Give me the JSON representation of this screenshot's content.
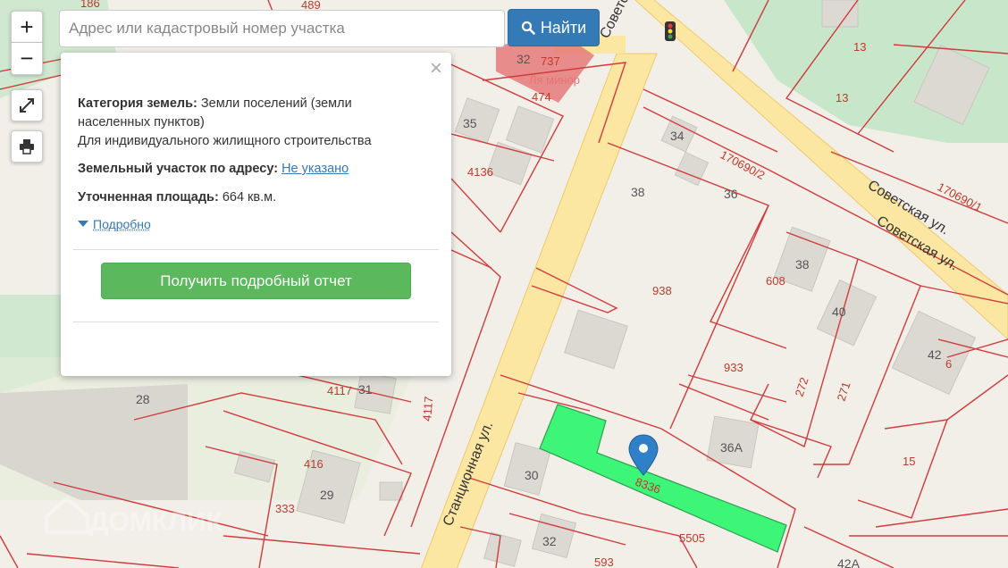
{
  "search": {
    "placeholder": "Адрес или кадастровый номер участка",
    "button_label": "Найти"
  },
  "controls": {
    "zoom_in": "+",
    "zoom_out": "−"
  },
  "popup": {
    "close": "×",
    "category_label": "Категория земель:",
    "category_value": "Земли поселений (земли населенных пунктов)",
    "category_use": "Для индивидуального жилищного строительства",
    "address_label": "Земельный участок по адресу:",
    "address_value": "Не указано",
    "area_label": "Уточненная площадь:",
    "area_value": "664 кв.м.",
    "details_link": "Подробно",
    "report_button": "Получить подробный отчет"
  },
  "map": {
    "streets": {
      "sovetskaya_1": "Советская ул.",
      "sovetskaya_2": "Советская ул.",
      "sovetskaya_top": "Советская ул.",
      "stantsionnaya": "Станционная ул."
    },
    "plot_numbers": {
      "p186": "186",
      "p489": "489",
      "p737": "737",
      "p474": "474",
      "p4136": "4136",
      "p170690_2": "170690/2",
      "p170690_1": "170690/1",
      "p13a": "13",
      "p13b": "13",
      "p938": "938",
      "p608": "608",
      "p933": "933",
      "p272": "272",
      "p271": "271",
      "p4117a": "4117",
      "p4117b": "4117",
      "p416": "416",
      "p333": "333",
      "p5505": "5505",
      "p593": "593",
      "p15": "15",
      "p6": "6",
      "p8336": "8336"
    },
    "house_numbers": {
      "h35": "35",
      "h32": "32",
      "h34": "34",
      "h36": "36",
      "h38a": "38",
      "h38b": "38",
      "h40": "40",
      "h42": "42",
      "h36a": "36А",
      "h31": "31",
      "h28": "28",
      "h29": "29",
      "h30": "30",
      "h32b": "32",
      "h42a": "42А"
    },
    "poi_label": "Ля минор",
    "watermark": "ДОМКЛИК"
  }
}
